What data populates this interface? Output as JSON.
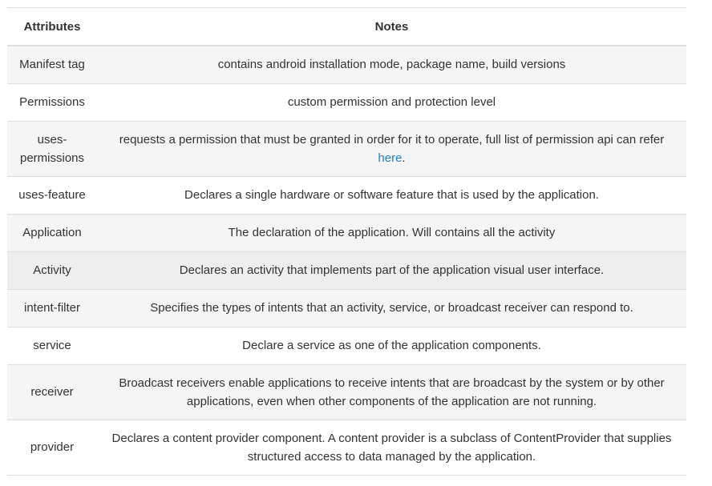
{
  "table": {
    "headers": {
      "attributes": "Attributes",
      "notes": "Notes"
    },
    "rows": [
      {
        "attribute": "Manifest tag",
        "notes": "contains android installation mode, package name, build versions"
      },
      {
        "attribute": "Permissions",
        "notes": "custom permission and protection level"
      },
      {
        "attribute": "uses-permissions",
        "notes": "requests a permission that must be granted in order for it to operate, full list of permission api can refer ",
        "link": "here",
        "after": "."
      },
      {
        "attribute": "uses-feature",
        "notes": "Declares a single hardware or software feature that is used by the application."
      },
      {
        "attribute": "Application",
        "notes": "The declaration of the application. Will contains all the activity"
      },
      {
        "attribute": "Activity",
        "notes": "Declares an activity that implements part of the application visual user interface."
      },
      {
        "attribute": "intent-filter",
        "notes": "Specifies the types of intents that an activity, service, or broadcast receiver can respond to."
      },
      {
        "attribute": "service",
        "notes": "Declare a service as one of the application components."
      },
      {
        "attribute": "receiver",
        "notes": "Broadcast receivers enable applications to receive intents that are broadcast by the system or by other applications, even when other components of the application are not running."
      },
      {
        "attribute": "provider",
        "notes": "Declares a content provider component. A content provider is a subclass of ContentProvider that supplies structured access to data managed by the application."
      }
    ]
  },
  "colors": {
    "stripe": "#f5f5f5",
    "hover": "#eeeeee",
    "border": "#dddddd",
    "link": "#1e80c8",
    "text": "#333333"
  }
}
